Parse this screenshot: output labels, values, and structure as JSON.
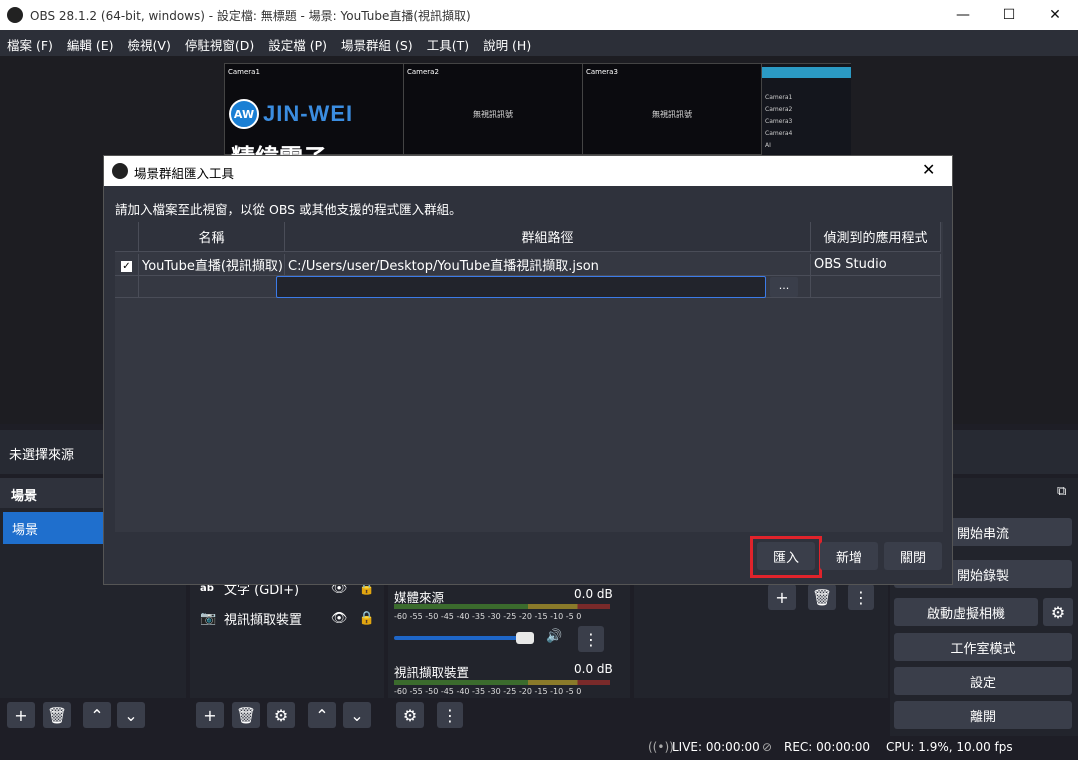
{
  "window": {
    "title": "OBS 28.1.2 (64-bit, windows) - 設定檔: 無標題 - 場景: YouTube直播(視訊擷取)",
    "minimize": "—",
    "maximize": "☐",
    "close": "✕"
  },
  "menu": [
    "檔案 (F)",
    "編輯 (E)",
    "檢視(V)",
    "停駐視窗(D)",
    "設定檔 (P)",
    "場景群組 (S)",
    "工具(T)",
    "說明 (H)"
  ],
  "preview": {
    "cameras": [
      "Camera1",
      "Camera2",
      "Camera3"
    ],
    "no_signal": "無視訊訊號",
    "logo_badge": "AW",
    "logo_text": "JIN-WEI",
    "logo_sub": "精緯電子",
    "side_items": [
      "Camera1",
      "Camera2",
      "Camera3",
      "Camera4",
      "AI"
    ]
  },
  "source_bar": {
    "label": "未選擇來源"
  },
  "scenes": {
    "header": "場景",
    "items": [
      "場景"
    ]
  },
  "sources": {
    "items": [
      {
        "label": "文字 (GDI+)",
        "icon": "text-icon"
      },
      {
        "label": "視訊擷取裝置",
        "icon": "camera-icon"
      }
    ]
  },
  "mixer": {
    "channels": [
      {
        "name": "媒體來源",
        "db": "0.0 dB"
      },
      {
        "name": "視訊擷取裝置",
        "db": "0.0 dB"
      }
    ],
    "ticks": "-60 -55 -50 -45 -40 -35 -30 -25 -20 -15 -10 -5 0",
    "volume_fraction": 0.9
  },
  "controls": {
    "start_stream": "開始串流",
    "start_record": "開始錄製",
    "virtual_cam": "啟動虛擬相機",
    "studio_mode": "工作室模式",
    "settings": "設定",
    "exit": "離開"
  },
  "status": {
    "live": "LIVE: 00:00:00",
    "rec": "REC: 00:00:00",
    "cpu": "CPU: 1.9%, 10.00 fps"
  },
  "dialog": {
    "title": "場景群組匯入工具",
    "instruction": "請加入檔案至此視窗，以從 OBS 或其他支援的程式匯入群組。",
    "columns": [
      "名稱",
      "群組路徑",
      "偵測到的應用程式"
    ],
    "rows": [
      {
        "checked": true,
        "name": "YouTube直播(視訊擷取)",
        "path": "C:/Users/user/Desktop/YouTube直播視訊擷取.json",
        "app": "OBS Studio"
      }
    ],
    "path_input_value": "",
    "browse": "...",
    "buttons": {
      "import": "匯入",
      "add": "新增",
      "close": "關閉"
    }
  }
}
